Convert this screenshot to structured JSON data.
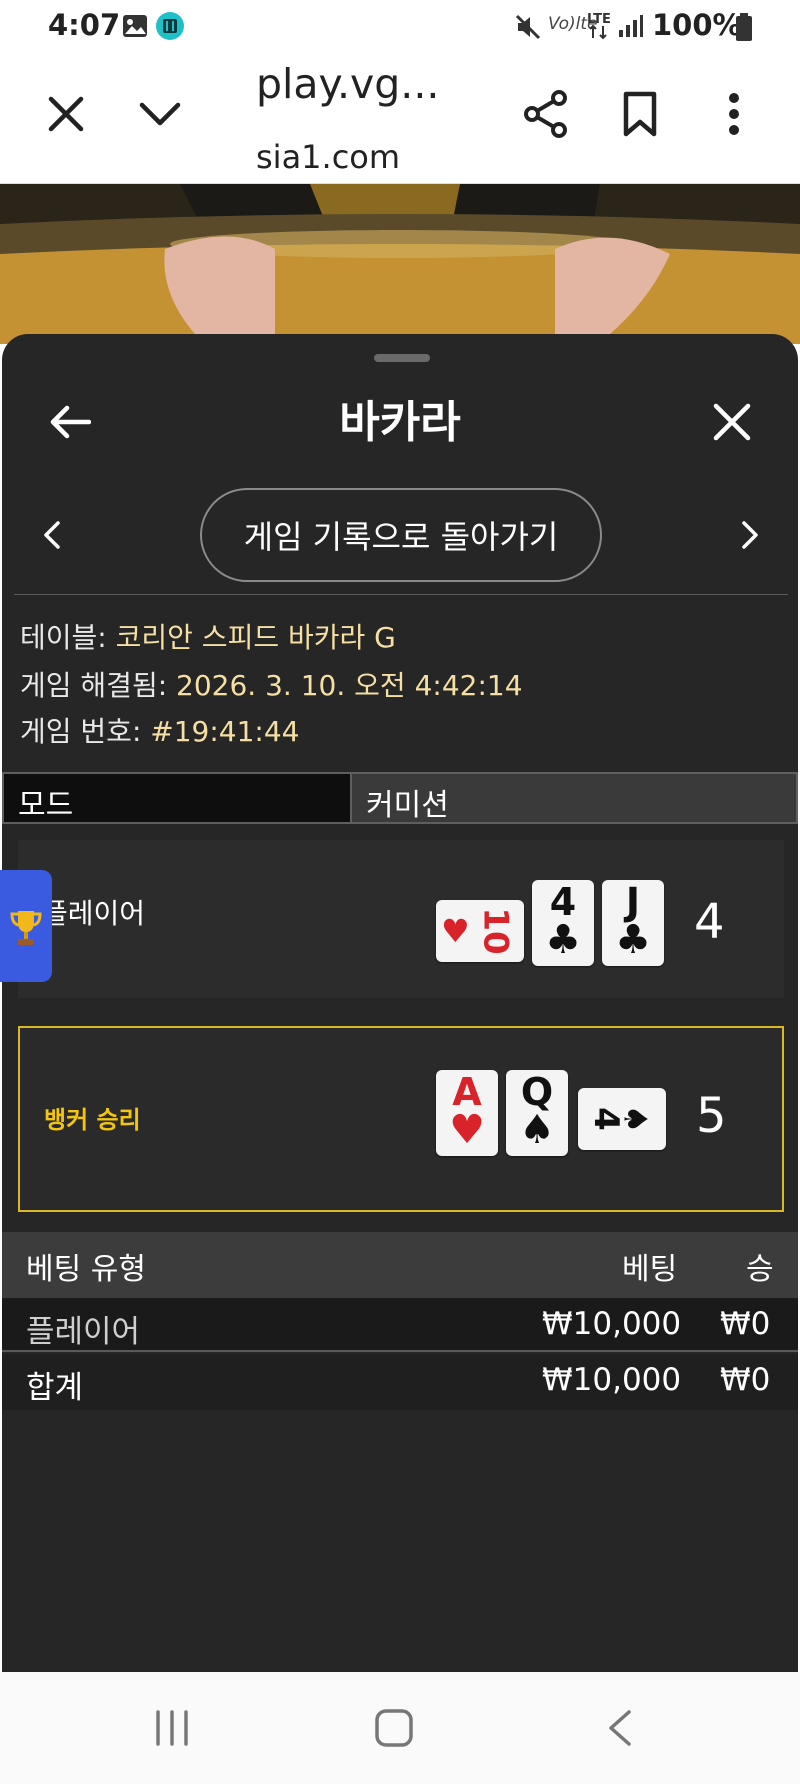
{
  "status_bar": {
    "time": "4:07",
    "battery": "100%"
  },
  "browser": {
    "url_line1": "play.vg...",
    "url_line2": "sia1.com"
  },
  "panel": {
    "title": "바카라",
    "history_button": "게임 기록으로 돌아가기",
    "info": {
      "table_label": "테이블:",
      "table_value": "코리안 스피드 바카라 G",
      "resolved_label": "게임 해결됨:",
      "resolved_value": "2026. 3. 10. 오전 4:42:14",
      "number_label": "게임 번호:",
      "number_value": "#19:41:44"
    },
    "tabs": {
      "mode": "모드",
      "commission": "커미션"
    },
    "player": {
      "label": "플레이어",
      "score": "4",
      "cards": [
        {
          "rank": "10",
          "suit": "♥",
          "color": "red",
          "rotated": true
        },
        {
          "rank": "4",
          "suit": "♣",
          "color": "black",
          "rotated": false
        },
        {
          "rank": "J",
          "suit": "♣",
          "color": "black",
          "rotated": false
        }
      ]
    },
    "banker": {
      "label": "뱅커 승리",
      "score": "5",
      "cards": [
        {
          "rank": "A",
          "suit": "♥",
          "color": "red",
          "rotated": false
        },
        {
          "rank": "Q",
          "suit": "♠",
          "color": "black",
          "rotated": false
        },
        {
          "rank": "4",
          "suit": "♠",
          "color": "black",
          "rotated": true
        }
      ]
    },
    "bets": {
      "headers": {
        "type": "베팅 유형",
        "bet": "베팅",
        "win": "승"
      },
      "rows": [
        {
          "type": "플레이어",
          "bet": "₩10,000",
          "win": "₩0"
        }
      ],
      "total": {
        "type": "합계",
        "bet": "₩10,000",
        "win": "₩0"
      }
    }
  },
  "colors": {
    "panel_bg": "#262626",
    "winner_border": "#d9b62a",
    "info_value": "#f5dfa3",
    "side_tab": "#3a5ae0"
  }
}
